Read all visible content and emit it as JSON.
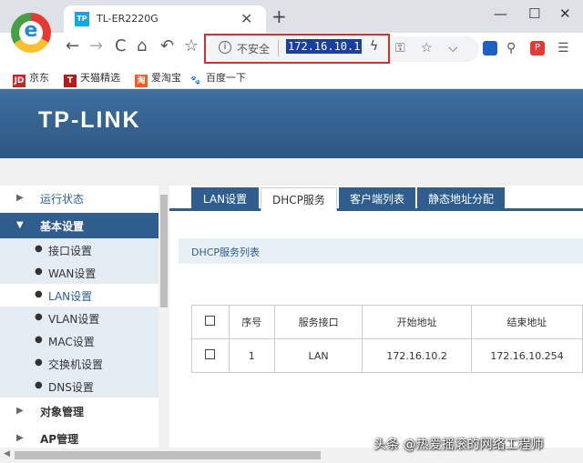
{
  "browser": {
    "tab_favicon": "TP",
    "tab_title": "TL-ER2220G",
    "tab_close": "✕",
    "new_tab": "+",
    "window_min": "—",
    "window_max": "☐",
    "window_close": "✕",
    "nav": {
      "back": "←",
      "forward": "→",
      "reload": "C",
      "home": "⌂",
      "undo": "↶",
      "star": "☆"
    },
    "address": {
      "info_glyph": "i",
      "security_label": "不安全",
      "url": "172.16.10.1",
      "bolt": "ϟ"
    },
    "toolbar_icons": {
      "key": "⚿",
      "star": "☆",
      "chevron": "⌵",
      "search": "⚲",
      "menu": "☰"
    },
    "ext_paw": "🐾",
    "ext_pdf": "P"
  },
  "bookmarks": [
    {
      "icon_text": "JD",
      "label": "京东",
      "icon_color": "#c62828"
    },
    {
      "icon_text": "T",
      "label": "天猫精选",
      "icon_color": "#b71c1c"
    },
    {
      "icon_text": "淘",
      "label": "爱淘宝",
      "icon_color": "#ff5722"
    },
    {
      "icon_text": "🐾",
      "label": "百度一下",
      "icon_color": "#1e88e5"
    }
  ],
  "page": {
    "brand": "TP-LINK",
    "sidebar": {
      "running_status": "运行状态",
      "basic_settings": "基本设置",
      "sub_items": [
        "接口设置",
        "WAN设置",
        "LAN设置",
        "VLAN设置",
        "MAC设置",
        "交换机设置",
        "DNS设置"
      ],
      "object_management": "对象管理",
      "ap_management": "AP管理"
    },
    "tabs": [
      "LAN设置",
      "DHCP服务",
      "客户端列表",
      "静态地址分配"
    ],
    "section_title": "DHCP服务列表",
    "table": {
      "headers": [
        "序号",
        "服务接口",
        "开始地址",
        "结束地址"
      ],
      "rows": [
        {
          "index": "1",
          "interface": "LAN",
          "start": "172.16.10.2",
          "end": "172.16.10.254"
        }
      ]
    }
  },
  "watermark": "头条 @热爱摇滚的网络工程师",
  "colors": {
    "brand_blue": "#2e5d8e",
    "highlight_red": "#d32f2f"
  }
}
